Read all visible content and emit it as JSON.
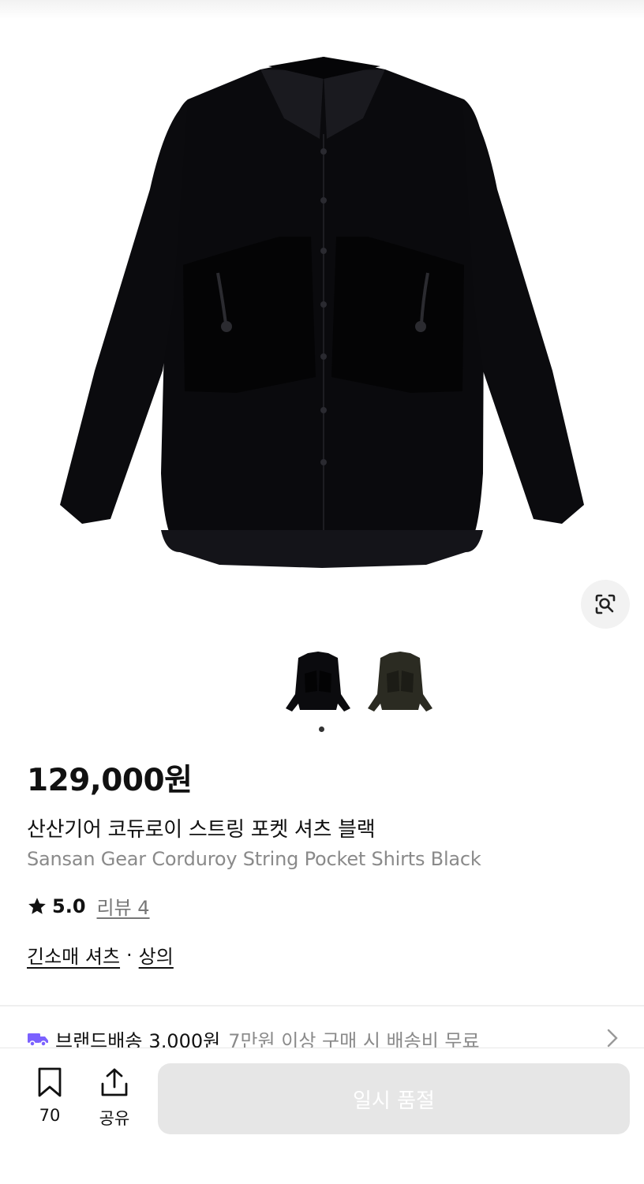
{
  "product": {
    "price": "129,000원",
    "title_ko": "산산기어 코듀로이 스트링 포켓 셔츠 블랙",
    "title_en": "Sansan Gear Corduroy String Pocket Shirts Black",
    "rating": "5.0",
    "review_label": "리뷰 4",
    "categories": [
      "긴소매 셔츠",
      "상의"
    ],
    "category_separator": "·"
  },
  "shipping": {
    "label": "브랜드배송",
    "fee": "3,000원",
    "note": "7만원 이상 구매 시 배송비 무료",
    "icon": "truck-icon",
    "icon_color": "#7b61ff"
  },
  "gallery": {
    "thumbnails": [
      "black",
      "khaki"
    ],
    "selected_index": 0
  },
  "bottom_bar": {
    "bookmark_count": "70",
    "share_label": "공유",
    "buy_button": "일시 품절"
  },
  "colors": {
    "shirt_black": "#0b0b0e",
    "shirt_khaki": "#2b2b22"
  }
}
